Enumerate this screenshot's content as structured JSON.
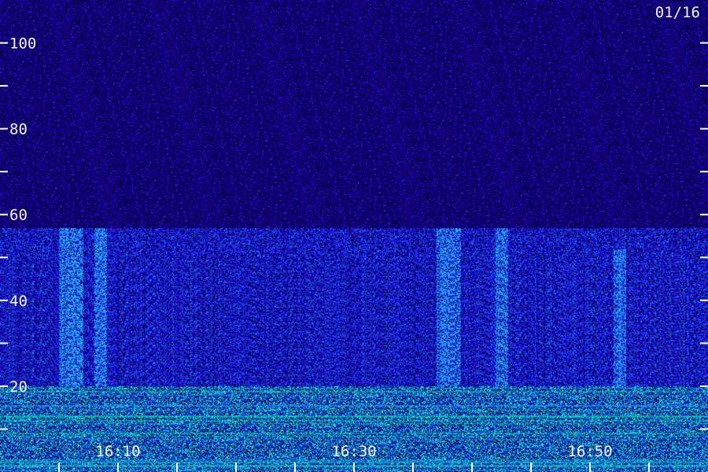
{
  "date_label": "01/16",
  "chart_data": {
    "type": "heatmap",
    "title": "",
    "xlabel": "",
    "ylabel": "",
    "ylim": [
      0,
      110
    ],
    "y_ticks": [
      10,
      20,
      30,
      40,
      50,
      60,
      70,
      80,
      90,
      100
    ],
    "y_tick_labels": [
      {
        "value": 20,
        "text": "20"
      },
      {
        "value": 40,
        "text": "40"
      },
      {
        "value": 60,
        "text": "60"
      },
      {
        "value": 80,
        "text": "80"
      },
      {
        "value": 100,
        "text": "100"
      }
    ],
    "x_range": [
      "16:00",
      "17:00"
    ],
    "x_ticks": [
      "16:05",
      "16:10",
      "16:15",
      "16:20",
      "16:25",
      "16:30",
      "16:35",
      "16:40",
      "16:45",
      "16:50",
      "16:55"
    ],
    "x_tick_labels": [
      {
        "time": "16:10",
        "text": "16:10"
      },
      {
        "time": "16:30",
        "text": "16:30"
      },
      {
        "time": "16:50",
        "text": "16:50"
      }
    ],
    "bands": [
      {
        "y_from": 0,
        "y_to": 20,
        "level": "high"
      },
      {
        "y_from": 20,
        "y_to": 57,
        "level": "medium"
      },
      {
        "y_from": 57,
        "y_to": 110,
        "level": "low"
      }
    ],
    "bursts": [
      {
        "time_from": "16:05",
        "time_to": "16:07",
        "y_to": 57
      },
      {
        "time_from": "16:08",
        "time_to": "16:09",
        "y_to": 57
      },
      {
        "time_from": "16:37",
        "time_to": "16:39",
        "y_to": 57
      },
      {
        "time_from": "16:42",
        "time_to": "16:43",
        "y_to": 57
      },
      {
        "time_from": "16:52",
        "time_to": "16:53",
        "y_to": 52
      }
    ],
    "colors": {
      "background": "#0a0060",
      "low": "#14009a",
      "medium": "#1a3cff",
      "high": "#00ff9c"
    }
  }
}
